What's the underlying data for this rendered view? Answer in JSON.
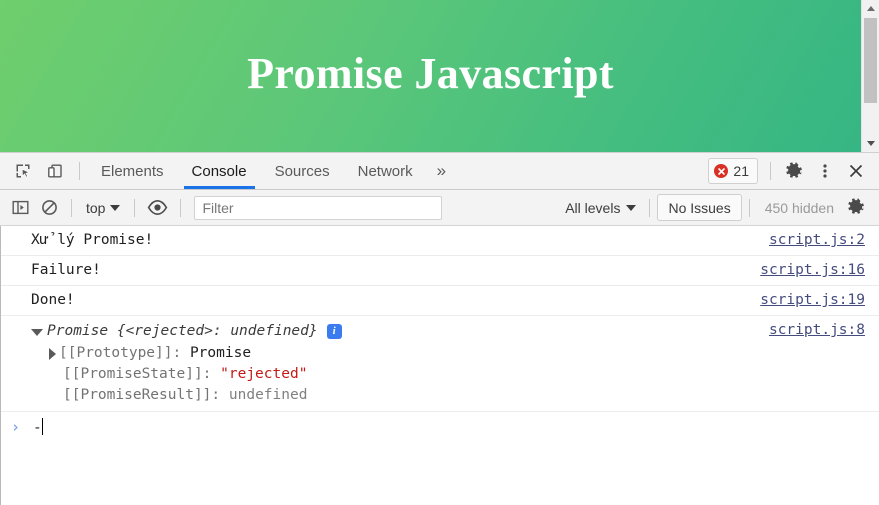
{
  "page": {
    "title": "Promise Javascript",
    "gradient_from": "#6fce6d",
    "gradient_to": "#36b684",
    "scrollbar": {
      "up_arrow": "scroll-up",
      "down_arrow": "scroll-down"
    }
  },
  "devtools": {
    "tabbar": {
      "inspect_icon": "inspect-element-icon",
      "device_icon": "device-toolbar-icon",
      "tabs": [
        {
          "label": "Elements",
          "active": false
        },
        {
          "label": "Console",
          "active": true
        },
        {
          "label": "Sources",
          "active": false
        },
        {
          "label": "Network",
          "active": false
        }
      ],
      "more_tabs": "»",
      "error_count": "21",
      "settings_icon": "gear-icon",
      "menu_icon": "kebab-menu-icon",
      "close_icon": "close-icon"
    },
    "console_toolbar": {
      "sidebar_toggle_icon": "console-sidebar-icon",
      "clear_icon": "clear-console-icon",
      "context_label": "top",
      "eye_icon": "live-expression-icon",
      "filter_placeholder": "Filter",
      "filter_value": "",
      "levels_label": "All levels",
      "issues_label": "No Issues",
      "hidden_label": "450 hidden",
      "settings_icon": "gear-icon"
    },
    "messages": [
      {
        "text": "Xử lý Promise!",
        "source": "script.js:2"
      },
      {
        "text": "Failure!",
        "source": "script.js:16"
      },
      {
        "text": "Done!",
        "source": "script.js:19"
      }
    ],
    "object_message": {
      "title": "Promise {<rejected>: undefined}",
      "info_badge": "i",
      "source": "script.js:8",
      "expanded": true,
      "props": [
        {
          "key": "[[Prototype]]: ",
          "value": "Promise",
          "kind": "plain",
          "expandable": true
        },
        {
          "key": "[[PromiseState]]: ",
          "value": "\"rejected\"",
          "kind": "string",
          "expandable": false
        },
        {
          "key": "[[PromiseResult]]: ",
          "value": "undefined",
          "kind": "undefined",
          "expandable": false
        }
      ]
    },
    "prompt": {
      "arrow": "›",
      "value": "-"
    }
  }
}
